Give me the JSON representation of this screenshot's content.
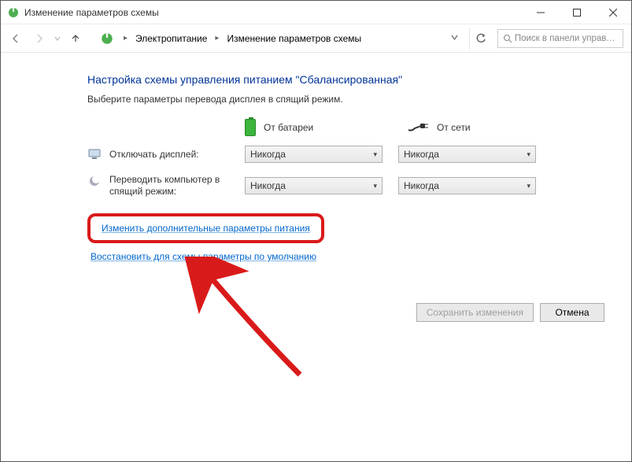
{
  "window": {
    "title": "Изменение параметров схемы"
  },
  "toolbar": {
    "breadcrumb": {
      "root": "Электропитание",
      "current": "Изменение параметров схемы"
    },
    "search_placeholder": "Поиск в панели управлен..."
  },
  "page": {
    "title": "Настройка схемы управления питанием \"Сбалансированная\"",
    "subtitle": "Выберите параметры перевода дисплея в спящий режим."
  },
  "columns": {
    "battery": "От батареи",
    "ac": "От сети"
  },
  "settings": {
    "display_off": {
      "label": "Отключать дисплей:",
      "battery_value": "Никогда",
      "ac_value": "Никогда"
    },
    "sleep": {
      "label": "Переводить компьютер в спящий режим:",
      "battery_value": "Никогда",
      "ac_value": "Никогда"
    }
  },
  "links": {
    "advanced": "Изменить дополнительные параметры питания",
    "restore": "Восстановить для схемы параметры по умолчанию"
  },
  "buttons": {
    "save": "Сохранить изменения",
    "cancel": "Отмена"
  }
}
